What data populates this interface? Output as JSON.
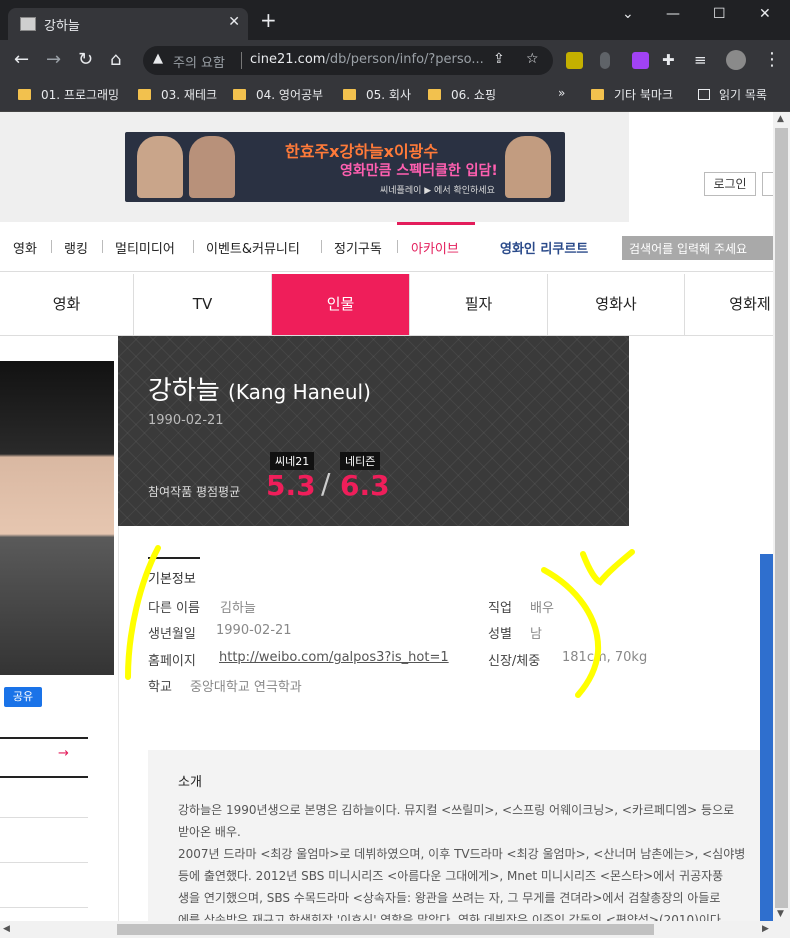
{
  "browser": {
    "tab_title": "강하늘",
    "tab_close": "✕",
    "new_tab": "+",
    "window_controls": [
      "⌄",
      "—",
      "☐",
      "✕"
    ],
    "omnibox": {
      "security_text": "주의 요함",
      "url_host": "cine21.com",
      "url_path": "/db/person/info/?perso..."
    },
    "bookmarks": [
      "01. 프로그래밍",
      "03. 재테크",
      "04. 영어공부",
      "05. 회사",
      "06. 쇼핑"
    ],
    "bookmarks_overflow": "»",
    "other_bookmarks": "기타 북마크",
    "reading_list": "읽기 목록"
  },
  "banner": {
    "line1": "한효주x강하늘x이광수",
    "line2": "영화만큼 스펙터클한 입담!",
    "line3": "씨네플레이 ▶ 에서 확인하세요"
  },
  "header": {
    "login_label": "로그인"
  },
  "nav": {
    "items": [
      "영화",
      "랭킹",
      "멀티미디어",
      "이벤트&커뮤니티",
      "정기구독",
      "아카이브"
    ],
    "recruit": "영화인 리쿠르트",
    "search_placeholder": "검색어를 입력해 주세요"
  },
  "subtabs": [
    "영화",
    "TV",
    "인물",
    "필자",
    "영화사",
    "영화제"
  ],
  "person": {
    "name_ko": "강하늘",
    "name_en": "(Kang Haneul)",
    "birth": "1990-02-21",
    "rating_label": "참여작품 평점평균",
    "cine21_tag": "씨네21",
    "netizen_tag": "네티즌",
    "cine21_score": "5.3",
    "score_sep": "/",
    "netizen_score": "6.3"
  },
  "sidebar": {
    "share_label": "공유",
    "arrow": "→"
  },
  "info": {
    "title": "기본정보",
    "fields": [
      {
        "label": "다른 이름",
        "value": "김하늘"
      },
      {
        "label": "생년월일",
        "value": "1990-02-21"
      },
      {
        "label": "홈페이지",
        "value": "http://weibo.com/galpos3?is_hot=1"
      },
      {
        "label": "학교",
        "value": "중앙대학교 연극학과"
      },
      {
        "label": "직업",
        "value": "배우"
      },
      {
        "label": "성별",
        "value": "남"
      },
      {
        "label": "신장/체중",
        "value": "181cm, 70kg"
      }
    ]
  },
  "intro": {
    "title": "소개",
    "lines": [
      "강하늘은 1990년생으로 본명은 김하늘이다. 뮤지컬 <쓰릴미>, <스프링 어웨이크닝>, <카르페디엠> 등으로",
      "받아온 배우.",
      "2007년 드라마 <최강 울엄마>로 데뷔하였으며, 이후 TV드라마 <최강 울엄마>, <산너머 남촌에는>, <심야병",
      "등에 출연했다. 2012년 SBS 미니시리즈 <아름다운 그대에게>, Mnet 미니시리즈 <몬스타>에서 귀공자풍 ",
      "생을 연기했으며, SBS 수목드라마 <상속자들: 왕관을 쓰려는 자, 그 무게를 견뎌라>에서 검찰총장의 아들로",
      "에를 상속받은 재규고 학생회장 '이효신' 역할을 맡았다. 영화 데뷔작은 이준익 감독의 <평양성>(2010)이다"
    ]
  },
  "colors": {
    "accent": "#ef1e5a",
    "hero_bg": "#3a3a3a",
    "chrome_dark": "#202124",
    "chrome_mid": "#35363a",
    "doodle": "#ffff00",
    "right_bar": "#2f6fce"
  }
}
